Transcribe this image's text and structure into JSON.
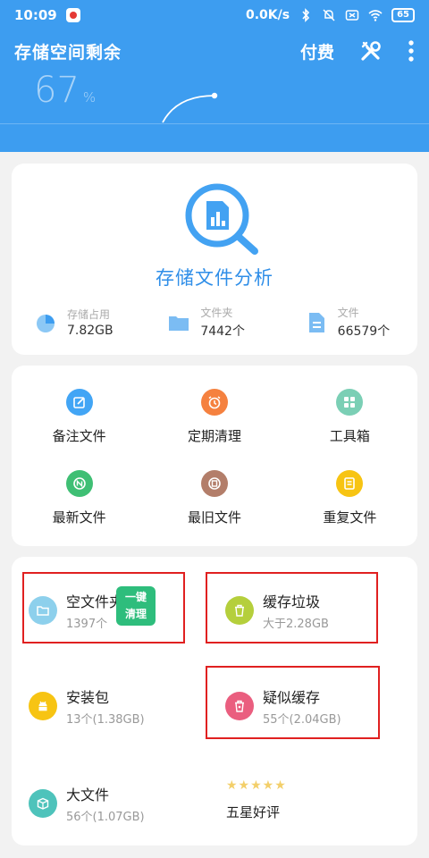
{
  "status": {
    "time": "10:09",
    "speed": "0.0K/s",
    "battery": "65"
  },
  "header": {
    "title": "存储空间剩余",
    "pay_label": "付费",
    "percent_value": "67",
    "percent_sign": "%"
  },
  "analysis": {
    "title": "存储文件分析",
    "stats": [
      {
        "label": "存储占用",
        "value": "7.82GB"
      },
      {
        "label": "文件夹",
        "value": "7442个"
      },
      {
        "label": "文件",
        "value": "66579个"
      }
    ]
  },
  "tools": [
    {
      "label": "备注文件",
      "color": "#42a5f5"
    },
    {
      "label": "定期清理",
      "color": "#f5813f"
    },
    {
      "label": "工具箱",
      "color": "#7bcfb5"
    },
    {
      "label": "最新文件",
      "color": "#3fbf74"
    },
    {
      "label": "最旧文件",
      "color": "#b37e6a"
    },
    {
      "label": "重复文件",
      "color": "#f7c413"
    }
  ],
  "cleanup": [
    {
      "title": "空文件夹",
      "sub": "1397个",
      "color": "#8dd0ec"
    },
    {
      "title": "缓存垃圾",
      "sub": "大于2.28GB",
      "color": "#b5cf3c"
    },
    {
      "title": "安装包",
      "sub": "13个(1.38GB)",
      "color": "#f7c413"
    },
    {
      "title": "疑似缓存",
      "sub": "55个(2.04GB)",
      "color": "#ea5e7f"
    },
    {
      "title": "大文件",
      "sub": "56个(1.07GB)",
      "color": "#4ec3bb"
    }
  ],
  "clean_button": {
    "line1": "一键",
    "line2": "清理"
  },
  "rating": {
    "stars": "★★★★★",
    "label": "五星好评"
  }
}
